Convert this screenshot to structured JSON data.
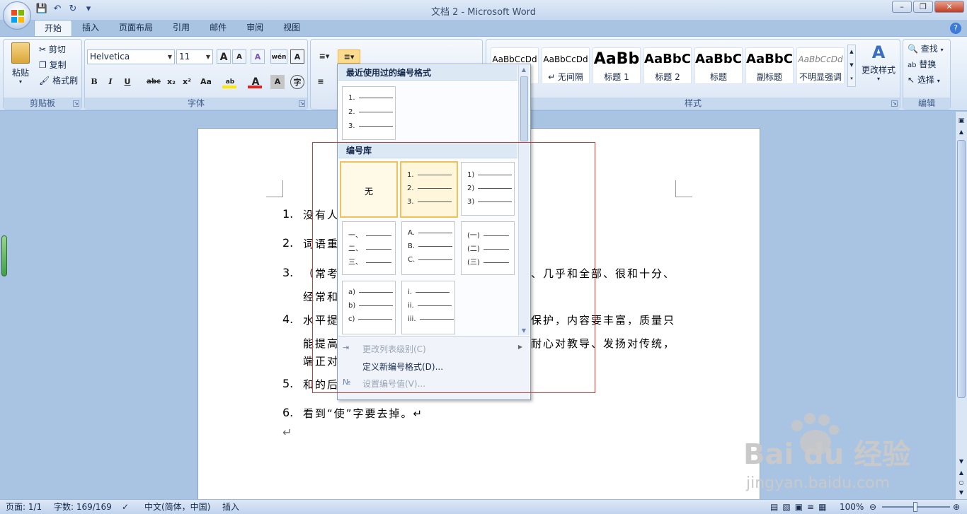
{
  "window": {
    "title": "文档 2 - Microsoft Word"
  },
  "tabs": [
    "开始",
    "插入",
    "页面布局",
    "引用",
    "邮件",
    "审阅",
    "视图"
  ],
  "clipboard": {
    "paste": "粘贴",
    "cut": "剪切",
    "copy": "复制",
    "format_painter": "格式刷",
    "label": "剪贴板"
  },
  "font": {
    "name": "Helvetica",
    "size": "11",
    "label": "字体",
    "bold": "B",
    "italic": "I",
    "underline": "U",
    "strike": "abc",
    "sub": "x₂",
    "sup": "x²",
    "case": "Aa",
    "grow": "A",
    "shrink": "A",
    "clear": "A",
    "phonetic": "wén",
    "border": "A",
    "highlight_color": "#ffe600",
    "font_color": "#e8201c"
  },
  "styles": {
    "label": "样式",
    "items": [
      {
        "sample": "AaBbCcDd",
        "name": ""
      },
      {
        "sample": "AaBbCcDd",
        "name": "↵ 无间隔"
      },
      {
        "sample": "AaBb",
        "name": "标题 1"
      },
      {
        "sample": "AaBbC",
        "name": "标题 2"
      },
      {
        "sample": "AaBbC",
        "name": "标题"
      },
      {
        "sample": "AaBbC",
        "name": "副标题"
      },
      {
        "sample": "AaBbCcDd",
        "name": "不明显强调"
      }
    ],
    "change": "更改样式"
  },
  "editing": {
    "find": "查找",
    "replace": "替换",
    "select": "选择",
    "label": "编辑"
  },
  "numbering_popup": {
    "recent_header": "最近使用过的编号格式",
    "recent": [
      [
        "1.",
        "2.",
        "3."
      ]
    ],
    "library_header": "编号库",
    "none_label": "无",
    "library": [
      [
        "1.",
        "2.",
        "3."
      ],
      [
        "1)",
        "2)",
        "3)"
      ],
      [
        "一、",
        "二、",
        "三、"
      ],
      [
        "A.",
        "B.",
        "C."
      ],
      [
        "(一)",
        "(二)",
        "(三)"
      ],
      [
        "a)",
        "b)",
        "c)"
      ],
      [
        "i.",
        "ii.",
        "iii."
      ]
    ],
    "commands": [
      {
        "label": "更改列表级别(C)",
        "enabled": false
      },
      {
        "label": "定义新编号格式(D)...",
        "enabled": true
      },
      {
        "label": "设置编号值(V)...",
        "enabled": false
      }
    ]
  },
  "document": {
    "items": [
      {
        "num": "1.",
        "lines": [
          "没有人"
        ]
      },
      {
        "num": "2.",
        "lines": [
          "词语重"
        ]
      },
      {
        "num": "3.",
        "lines": [
          "（常考",
          "经常和"
        ]
      },
      {
        "num": "4.",
        "lines": [
          "水平提",
          "能提高",
          "端正对"
        ]
      },
      {
        "num": "5.",
        "lines": [
          "和的后"
        ]
      },
      {
        "num": "6.",
        "lines": [
          "看到“使”字要去掉。↵"
        ]
      }
    ],
    "right_fragments": [
      "、几乎和全部、很和十分、",
      "保护，内容要丰富，质量只",
      "耐心对教导、发扬对传统，"
    ],
    "end_mark": "↵"
  },
  "status": {
    "page": "页面: 1/1",
    "words": "字数: 169/169",
    "lang": "中文(简体，中国)",
    "mode": "插入",
    "zoom": "100%"
  },
  "watermark": {
    "brand": "Bai du 经验",
    "url": "jingyan.baidu.com"
  }
}
